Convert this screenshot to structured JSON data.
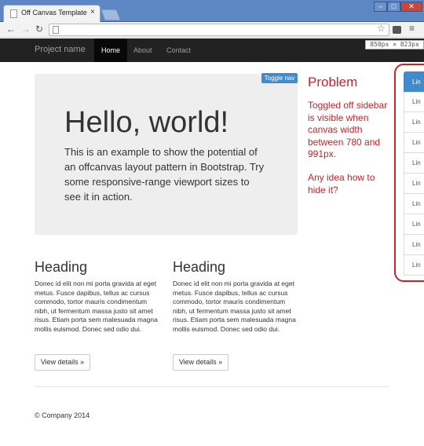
{
  "browser": {
    "tab_title": "Off Canvas Template for B",
    "tab_close": "×",
    "win_min": "–",
    "win_max": "□",
    "win_close": "✕",
    "back": "←",
    "forward": "→",
    "reload": "↻",
    "star": "☆",
    "menu": "≡"
  },
  "dimensions_badge": "850px × 823px",
  "navbar": {
    "brand": "Project name",
    "links": [
      "Home",
      "About",
      "Contact"
    ],
    "active_index": 0
  },
  "toggle_nav": "Toggle nav",
  "jumbotron": {
    "title": "Hello, world!",
    "text": "This is an example to show the potential of an offcanvas layout pattern in Bootstrap. Try some responsive-range viewport sizes to see it in action."
  },
  "problem": {
    "title": "Problem",
    "text": "Toggled off sidebar is visible when canvas width between 780 and 991px.",
    "question": "Any idea how to hide it?"
  },
  "sidebar": {
    "items": [
      "Lin",
      "Lin",
      "Lin",
      "Lin",
      "Lin",
      "Lin",
      "Lin",
      "Lin",
      "Lin",
      "Lin"
    ]
  },
  "columns": [
    {
      "heading": "Heading",
      "text": "Donec id elit non mi porta gravida at eget metus. Fusce dapibus, tellus ac cursus commodo, tortor mauris condimentum nibh, ut fermentum massa justo sit amet risus. Etiam porta sem malesuada magna mollis euismod. Donec sed odio dui.",
      "button": "View details »"
    },
    {
      "heading": "Heading",
      "text": "Donec id elit non mi porta gravida at eget metus. Fusce dapibus, tellus ac cursus commodo, tortor mauris condimentum nibh, ut fermentum massa justo sit amet risus. Etiam porta sem malesuada magna mollis euismod. Donec sed odio dui.",
      "button": "View details »"
    }
  ],
  "footer": "© Company 2014",
  "colors": {
    "accent": "#428bca",
    "problem": "#c0262d",
    "navbar": "#222222",
    "jumbotron": "#eeeeee"
  }
}
